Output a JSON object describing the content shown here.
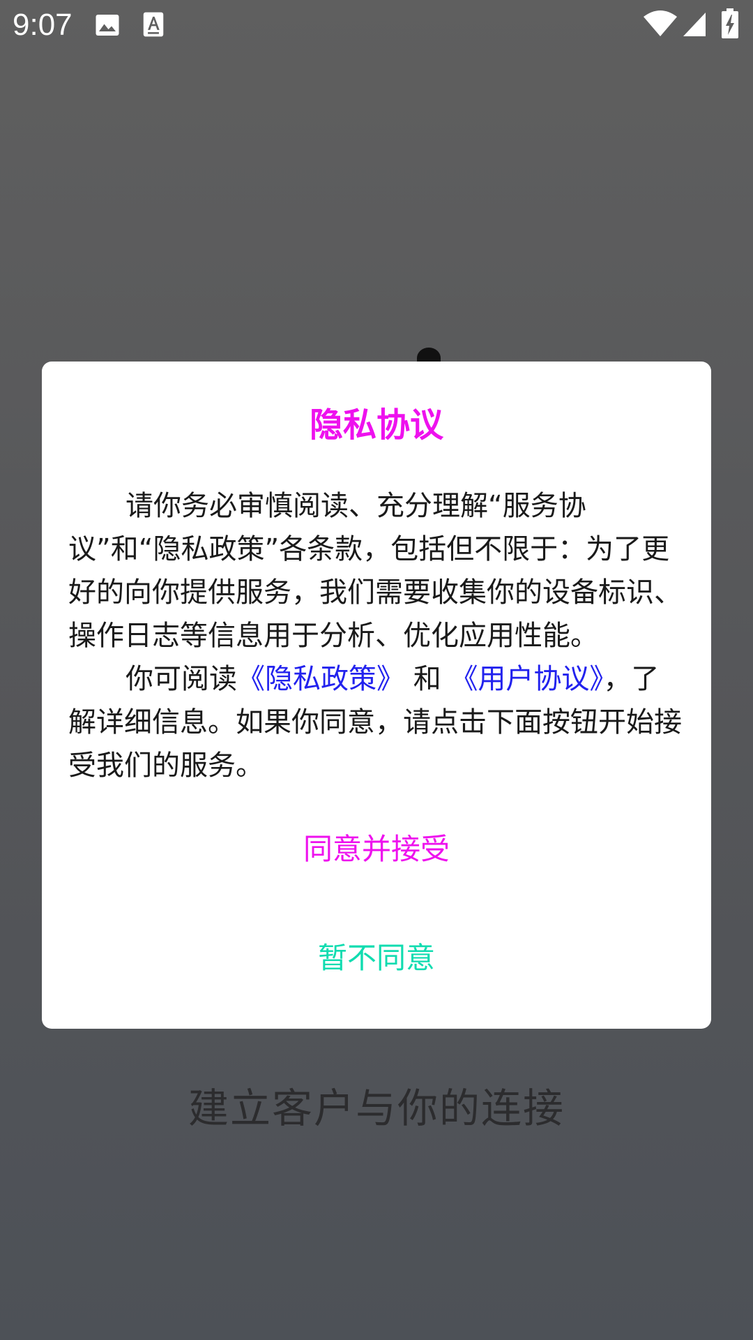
{
  "status_bar": {
    "time": "9:07",
    "icons": [
      "image-icon",
      "text-file-icon",
      "wifi-icon",
      "signal-icon",
      "battery-charging-icon"
    ]
  },
  "background": {
    "slogan": "建立客户与你的连接"
  },
  "dialog": {
    "title": "隐私协议",
    "paragraph1": "请你务必审慎阅读、充分理解“服务协议”和“隐私政策”各条款，包括但不限于：为了更好的向你提供服务，我们需要收集你的设备标识、操作日志等信息用于分析、优化应用性能。",
    "paragraph2_prefix": "你可阅读",
    "privacy_link": "《隐私政策》",
    "and_text": " 和 ",
    "user_link": "《用户协议》",
    "paragraph2_suffix": "，了解详细信息。如果你同意，请点击下面按钮开始接受我们的服务。",
    "agree_button": "同意并接受",
    "decline_button": "暂不同意"
  },
  "colors": {
    "title": "#ee11ee",
    "agree": "#ee11ee",
    "decline": "#11dcb0",
    "link": "#2222ee",
    "overlay": "#5a5a5c"
  }
}
